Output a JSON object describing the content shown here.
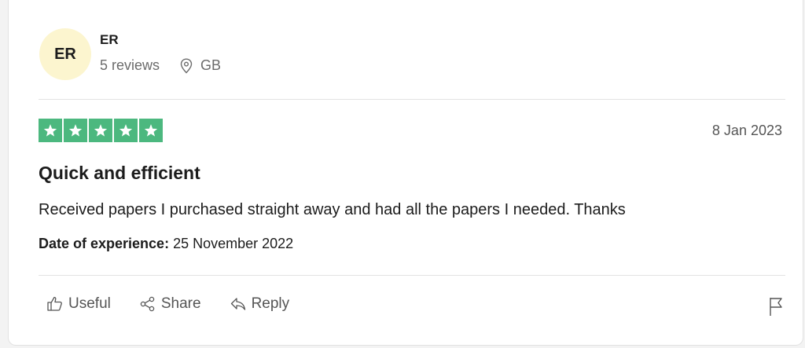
{
  "reviewer": {
    "initials": "ER",
    "name": "ER",
    "reviews_count": "5 reviews",
    "country": "GB"
  },
  "review": {
    "rating": 5,
    "max_rating": 5,
    "star_color": "#4cb87f",
    "date": "8 Jan 2023",
    "title": "Quick and efficient",
    "body": "Received papers I purchased straight away and had all the papers I needed. Thanks",
    "experience_label": "Date of experience:",
    "experience_date": "25 November 2022"
  },
  "actions": {
    "useful": "Useful",
    "share": "Share",
    "reply": "Reply"
  },
  "icons": {
    "location": "location-pin-icon",
    "useful": "thumbs-up-icon",
    "share": "share-icon",
    "reply": "reply-icon",
    "flag": "flag-icon",
    "star": "star-icon"
  }
}
